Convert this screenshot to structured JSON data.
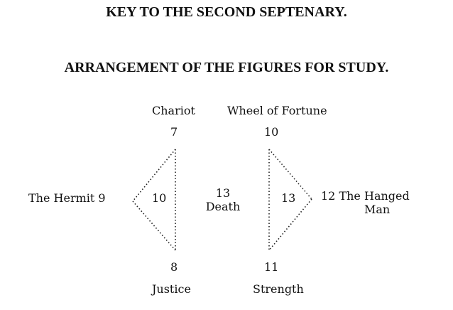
{
  "headings": {
    "title": "KEY TO THE SECOND SEPTENARY.",
    "subtitle": "ARRANGEMENT OF THE FIGURES FOR STUDY."
  },
  "figures": {
    "chariot": {
      "name": "Chariot",
      "number": "7"
    },
    "wheel": {
      "name": "Wheel of Fortune",
      "number": "10"
    },
    "hermit": {
      "name": "The Hermit",
      "number": "9"
    },
    "left_inner": {
      "number": "10"
    },
    "death": {
      "number": "13",
      "name": "Death"
    },
    "right_inner": {
      "number": "13"
    },
    "hanged": {
      "number": "12",
      "name_line1": "The Hanged",
      "name_line2": "Man"
    },
    "justice": {
      "name": "Justice",
      "number": "8"
    },
    "strength": {
      "name": "Strength",
      "number": "11"
    }
  }
}
